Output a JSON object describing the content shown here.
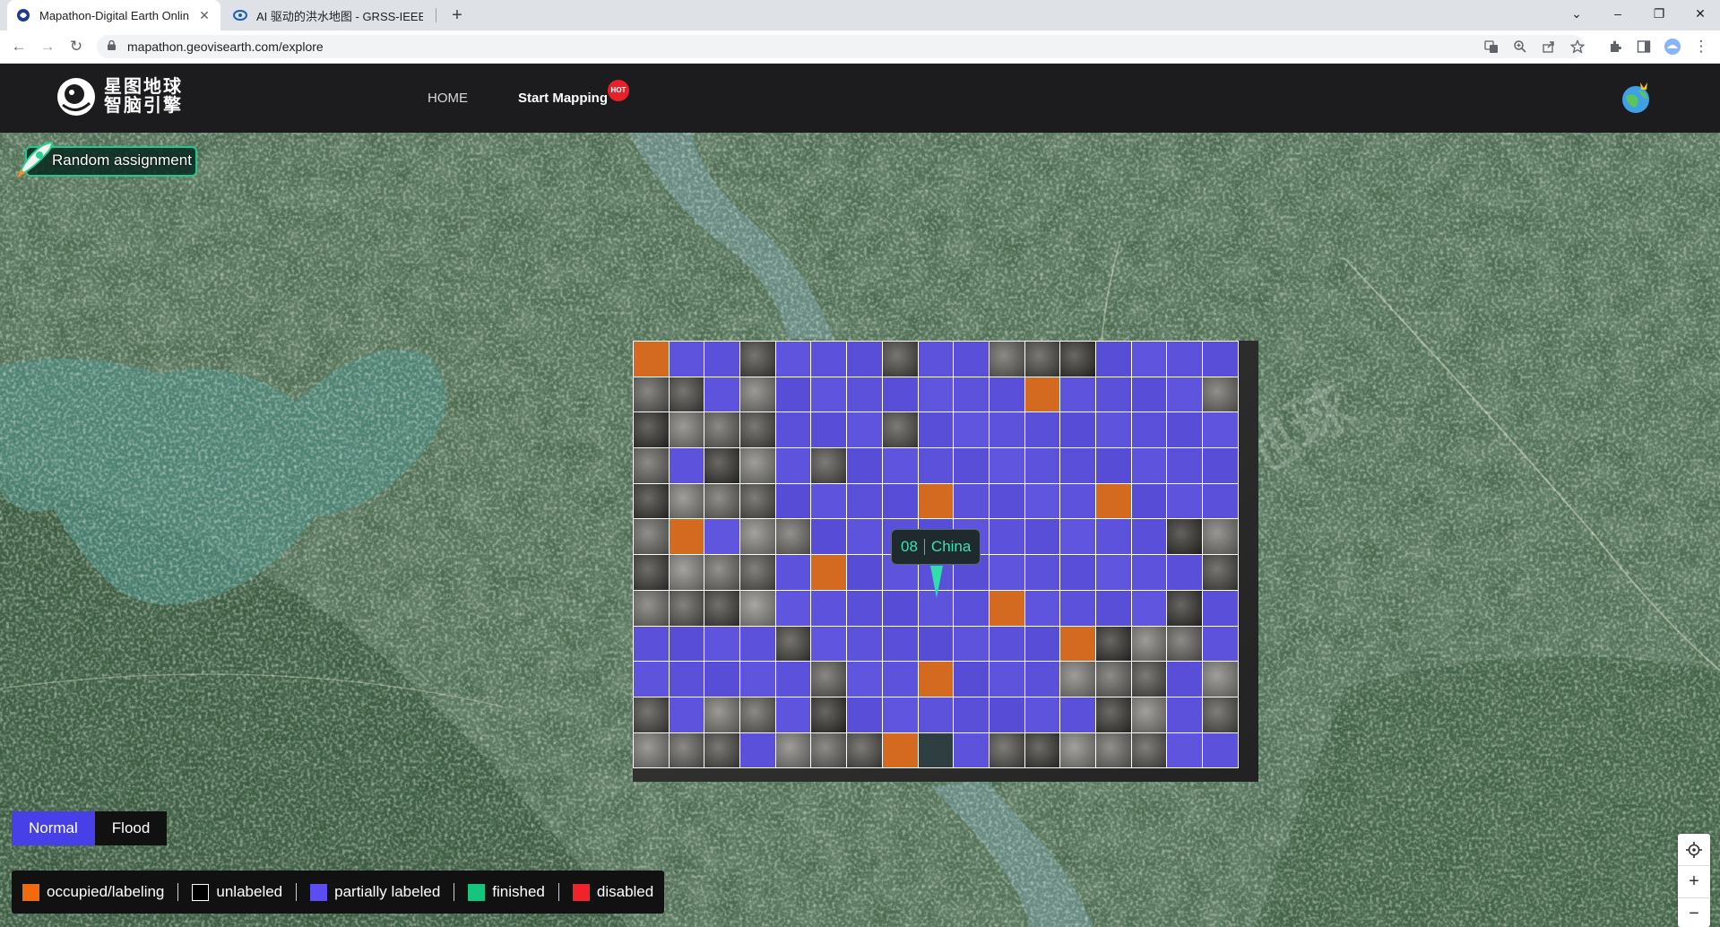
{
  "browser": {
    "tabs": [
      {
        "title": "Mapathon-Digital Earth Onlin",
        "active": true
      },
      {
        "title": "AI 驱动的洪水地图 - GRSS-IEEE",
        "active": false
      }
    ],
    "close_glyph": "✕",
    "new_tab_glyph": "+",
    "window_controls": {
      "dropdown": "⌄",
      "minimize": "–",
      "restore": "❐",
      "close": "✕"
    },
    "nav": {
      "back": "←",
      "forward": "→",
      "reload": "↻"
    },
    "url": "mapathon.geovisearth.com/explore"
  },
  "header": {
    "logo_line1": "星图地球",
    "logo_line2": "智脑引擎",
    "nav_home": "HOME",
    "nav_start": "Start Mapping",
    "hot_badge": "HOT"
  },
  "map": {
    "random_assignment": "Random assignment",
    "watermark": "地球",
    "tooltip_code": "08",
    "tooltip_region": "China",
    "grid": [
      "oppupppuppuuuppp",
      "uupupppppppoppppu",
      "uuuupppuppppppppp",
      "upuupuppppppppppp",
      "uuuuppppoppppoppp",
      "uopuuppppppppppuu",
      "uuuupoppppppppppuu",
      "uuuuppppppoppppup",
      "ppppupppppppouuup",
      "pppppuppopppuuupu",
      "upuupupppppppuupu",
      "uuupuuuonpuuuuupp"
    ],
    "mode_normal": "Normal",
    "mode_flood": "Flood",
    "legend": [
      {
        "label": "occupied/labeling",
        "color": "#f26a0f"
      },
      {
        "label": "unlabeled",
        "color": "#000000"
      },
      {
        "label": "partially labeled",
        "color": "#5b4df0"
      },
      {
        "label": "finished",
        "color": "#17c47e"
      },
      {
        "label": "disabled",
        "color": "#f0222a"
      }
    ],
    "zoom_in": "+",
    "zoom_out": "−"
  }
}
